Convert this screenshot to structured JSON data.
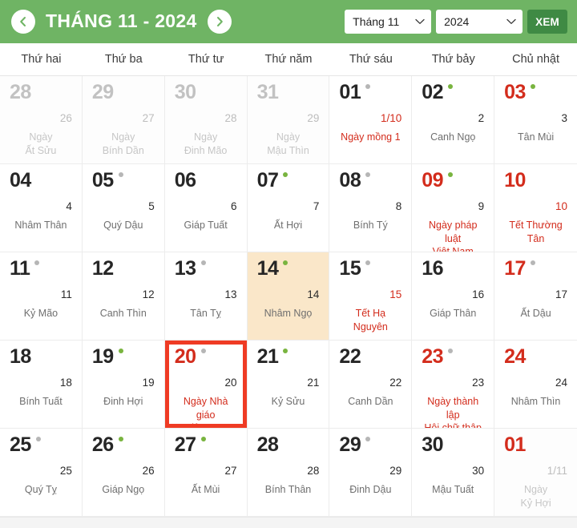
{
  "header": {
    "title": "THÁNG 11 - 2024",
    "prev_icon": "chevron-left-icon",
    "next_icon": "chevron-right-icon",
    "month_select_value": "Tháng 11",
    "year_select_value": "2024",
    "view_button_label": "XEM",
    "bar_color": "#6FB464",
    "button_color": "#3F8A44"
  },
  "weekdays": [
    "Thứ hai",
    "Thứ ba",
    "Thứ tư",
    "Thứ năm",
    "Thứ sáu",
    "Thứ bảy",
    "Chủ nhật"
  ],
  "colors": {
    "holiday_red": "#D32C1C",
    "selected_border": "#EF3B24",
    "today_background": "#FAE7C9",
    "dot_green": "#79B43F",
    "dot_gray": "#b6b6b6",
    "muted_text": "#c2c2c2"
  },
  "days": [
    {
      "solar": "28",
      "lunar": "26",
      "note": "Ngày\nẤt Sửu",
      "state": "muted",
      "dot": "none",
      "solar_color": "gray",
      "lunar_color": "gray",
      "note_color": "gray"
    },
    {
      "solar": "29",
      "lunar": "27",
      "note": "Ngày\nBính Dần",
      "state": "muted",
      "dot": "none",
      "solar_color": "gray",
      "lunar_color": "gray",
      "note_color": "gray"
    },
    {
      "solar": "30",
      "lunar": "28",
      "note": "Ngày\nĐinh Mão",
      "state": "muted",
      "dot": "none",
      "solar_color": "gray",
      "lunar_color": "gray",
      "note_color": "gray"
    },
    {
      "solar": "31",
      "lunar": "29",
      "note": "Ngày\nMậu Thìn",
      "state": "muted",
      "dot": "none",
      "solar_color": "gray",
      "lunar_color": "gray",
      "note_color": "gray"
    },
    {
      "solar": "01",
      "lunar": "1/10",
      "note": "Ngày mồng 1",
      "state": "normal",
      "dot": "gray",
      "solar_color": "dark",
      "lunar_color": "red",
      "note_color": "red"
    },
    {
      "solar": "02",
      "lunar": "2",
      "note": "Canh Ngọ",
      "state": "normal",
      "dot": "green",
      "solar_color": "dark",
      "lunar_color": "dark",
      "note_color": "gray-text"
    },
    {
      "solar": "03",
      "lunar": "3",
      "note": "Tân Mùi",
      "state": "normal",
      "dot": "green",
      "solar_color": "red",
      "lunar_color": "dark",
      "note_color": "gray-text"
    },
    {
      "solar": "04",
      "lunar": "4",
      "note": "Nhâm Thân",
      "state": "normal",
      "dot": "none",
      "solar_color": "dark",
      "lunar_color": "dark",
      "note_color": "gray-text"
    },
    {
      "solar": "05",
      "lunar": "5",
      "note": "Quý Dậu",
      "state": "normal",
      "dot": "gray",
      "solar_color": "dark",
      "lunar_color": "dark",
      "note_color": "gray-text"
    },
    {
      "solar": "06",
      "lunar": "6",
      "note": "Giáp Tuất",
      "state": "normal",
      "dot": "none",
      "solar_color": "dark",
      "lunar_color": "dark",
      "note_color": "gray-text"
    },
    {
      "solar": "07",
      "lunar": "7",
      "note": "Ất Hợi",
      "state": "normal",
      "dot": "green",
      "solar_color": "dark",
      "lunar_color": "dark",
      "note_color": "gray-text"
    },
    {
      "solar": "08",
      "lunar": "8",
      "note": "Bính Tý",
      "state": "normal",
      "dot": "gray",
      "solar_color": "dark",
      "lunar_color": "dark",
      "note_color": "gray-text"
    },
    {
      "solar": "09",
      "lunar": "9",
      "note": "Ngày pháp luật\nViệt Nam",
      "state": "normal",
      "dot": "green",
      "solar_color": "red",
      "lunar_color": "dark",
      "note_color": "red"
    },
    {
      "solar": "10",
      "lunar": "10",
      "note": "Tết Thường\nTân",
      "state": "normal",
      "dot": "none",
      "solar_color": "red",
      "lunar_color": "red",
      "note_color": "red"
    },
    {
      "solar": "11",
      "lunar": "11",
      "note": "Kỷ Mão",
      "state": "normal",
      "dot": "gray",
      "solar_color": "dark",
      "lunar_color": "dark",
      "note_color": "gray-text"
    },
    {
      "solar": "12",
      "lunar": "12",
      "note": "Canh Thìn",
      "state": "normal",
      "dot": "none",
      "solar_color": "dark",
      "lunar_color": "dark",
      "note_color": "gray-text"
    },
    {
      "solar": "13",
      "lunar": "13",
      "note": "Tân Tỵ",
      "state": "normal",
      "dot": "gray",
      "solar_color": "dark",
      "lunar_color": "dark",
      "note_color": "gray-text"
    },
    {
      "solar": "14",
      "lunar": "14",
      "note": "Nhâm Ngọ",
      "state": "today",
      "dot": "green",
      "solar_color": "dark",
      "lunar_color": "dark",
      "note_color": "gray-text"
    },
    {
      "solar": "15",
      "lunar": "15",
      "note": "Tết Hạ Nguyên",
      "state": "normal",
      "dot": "gray",
      "solar_color": "dark",
      "lunar_color": "red",
      "note_color": "red"
    },
    {
      "solar": "16",
      "lunar": "16",
      "note": "Giáp Thân",
      "state": "normal",
      "dot": "none",
      "solar_color": "dark",
      "lunar_color": "dark",
      "note_color": "gray-text"
    },
    {
      "solar": "17",
      "lunar": "17",
      "note": "Ất Dậu",
      "state": "normal",
      "dot": "gray",
      "solar_color": "red",
      "lunar_color": "dark",
      "note_color": "gray-text"
    },
    {
      "solar": "18",
      "lunar": "18",
      "note": "Bính Tuất",
      "state": "normal",
      "dot": "none",
      "solar_color": "dark",
      "lunar_color": "dark",
      "note_color": "gray-text"
    },
    {
      "solar": "19",
      "lunar": "19",
      "note": "Đinh Hợi",
      "state": "normal",
      "dot": "green",
      "solar_color": "dark",
      "lunar_color": "dark",
      "note_color": "gray-text"
    },
    {
      "solar": "20",
      "lunar": "20",
      "note": "Ngày Nhà giáo\nViệt Nam",
      "state": "selected",
      "dot": "gray",
      "solar_color": "red",
      "lunar_color": "dark",
      "note_color": "red"
    },
    {
      "solar": "21",
      "lunar": "21",
      "note": "Kỷ Sửu",
      "state": "normal",
      "dot": "green",
      "solar_color": "dark",
      "lunar_color": "dark",
      "note_color": "gray-text"
    },
    {
      "solar": "22",
      "lunar": "22",
      "note": "Canh Dần",
      "state": "normal",
      "dot": "none",
      "solar_color": "dark",
      "lunar_color": "dark",
      "note_color": "gray-text"
    },
    {
      "solar": "23",
      "lunar": "23",
      "note": "Ngày thành lập\nHội chữ thập\nđỏ VN",
      "state": "normal",
      "dot": "gray",
      "solar_color": "red",
      "lunar_color": "dark",
      "note_color": "red"
    },
    {
      "solar": "24",
      "lunar": "24",
      "note": "Nhâm Thìn",
      "state": "normal",
      "dot": "none",
      "solar_color": "red",
      "lunar_color": "dark",
      "note_color": "gray-text"
    },
    {
      "solar": "25",
      "lunar": "25",
      "note": "Quý Tỵ",
      "state": "normal",
      "dot": "gray",
      "solar_color": "dark",
      "lunar_color": "dark",
      "note_color": "gray-text"
    },
    {
      "solar": "26",
      "lunar": "26",
      "note": "Giáp Ngọ",
      "state": "normal",
      "dot": "green",
      "solar_color": "dark",
      "lunar_color": "dark",
      "note_color": "gray-text"
    },
    {
      "solar": "27",
      "lunar": "27",
      "note": "Ất Mùi",
      "state": "normal",
      "dot": "green",
      "solar_color": "dark",
      "lunar_color": "dark",
      "note_color": "gray-text"
    },
    {
      "solar": "28",
      "lunar": "28",
      "note": "Bính Thân",
      "state": "normal",
      "dot": "none",
      "solar_color": "dark",
      "lunar_color": "dark",
      "note_color": "gray-text"
    },
    {
      "solar": "29",
      "lunar": "29",
      "note": "Đinh Dậu",
      "state": "normal",
      "dot": "gray",
      "solar_color": "dark",
      "lunar_color": "dark",
      "note_color": "gray-text"
    },
    {
      "solar": "30",
      "lunar": "30",
      "note": "Mậu Tuất",
      "state": "normal",
      "dot": "none",
      "solar_color": "dark",
      "lunar_color": "dark",
      "note_color": "gray-text"
    },
    {
      "solar": "01",
      "lunar": "1/11",
      "note": "Ngày\nKỷ Hợi",
      "state": "muted",
      "dot": "none",
      "solar_color": "red",
      "lunar_color": "gray",
      "note_color": "gray"
    }
  ]
}
